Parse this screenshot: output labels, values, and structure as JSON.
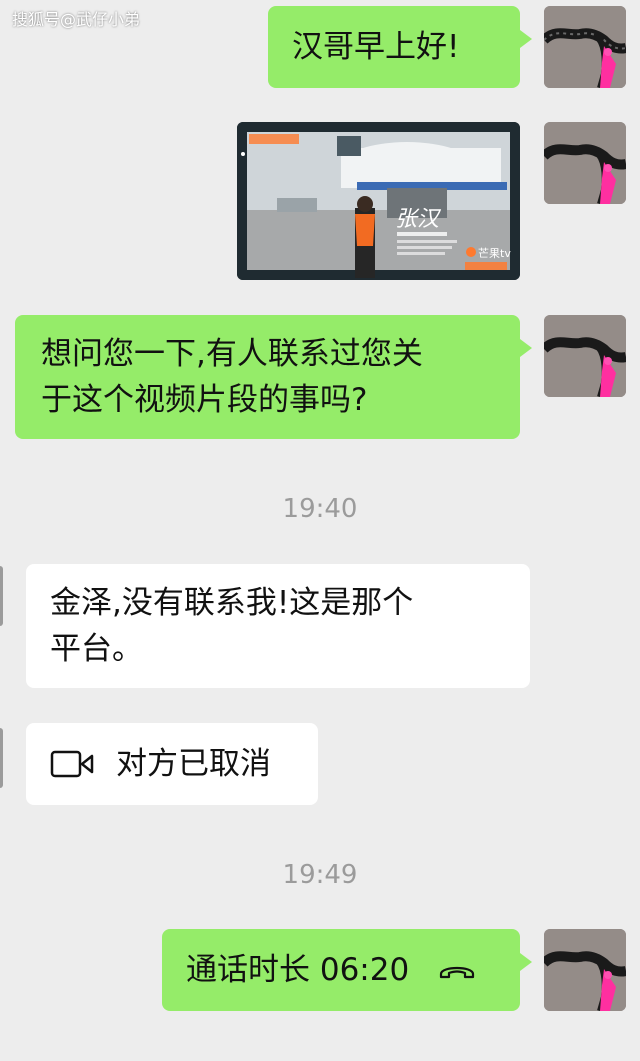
{
  "watermark": "搜狐号@武仔小弟",
  "messages": {
    "m1": "汉哥早上好!",
    "m3_line1": "想问您一下,有人联系过您关",
    "m3_line2": "于这个视频片段的事吗?",
    "m4_line1": "金泽,没有联系我!这是那个",
    "m4_line2": "平台。",
    "m5": "对方已取消",
    "m6": "通话时长 06:20"
  },
  "timestamps": {
    "t1": "19:40",
    "t2": "19:49"
  },
  "video": {
    "name_overlay": "张汉",
    "channel_logo": "芒果tv"
  },
  "colors": {
    "background": "#ededed",
    "sent_bubble": "#95ec69",
    "received_bubble": "#ffffff",
    "timestamp_text": "#9b9b9b"
  }
}
